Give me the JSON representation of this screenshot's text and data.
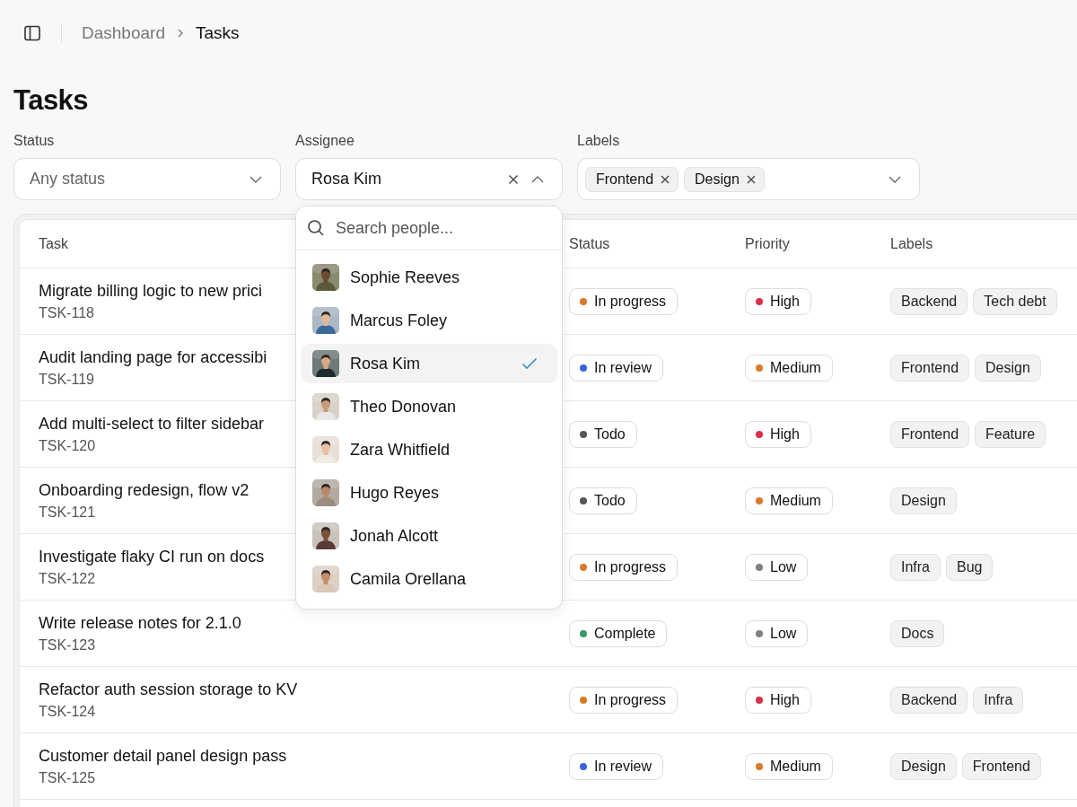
{
  "breadcrumb": [
    {
      "label": "Dashboard",
      "current": false
    },
    {
      "label": "Tasks",
      "current": true
    }
  ],
  "title": "Tasks",
  "filters": [
    {
      "kind": "select",
      "label": "Status",
      "placeholder": "Any status",
      "expanded": false
    },
    {
      "kind": "select",
      "label": "Assignee",
      "value": "Rosa Kim",
      "expanded": true,
      "clearable": true
    },
    {
      "kind": "tags",
      "label": "Labels",
      "tags": [
        "Frontend",
        "Design"
      ],
      "expanded": false
    }
  ],
  "people_menu": {
    "search_placeholder": "Search people...",
    "people": [
      {
        "name": "Sophie Reeves",
        "selected": false
      },
      {
        "name": "Marcus Foley",
        "selected": false
      },
      {
        "name": "Rosa Kim",
        "selected": true
      },
      {
        "name": "Theo Donovan",
        "selected": false
      },
      {
        "name": "Zara Whitfield",
        "selected": false
      },
      {
        "name": "Hugo Reyes",
        "selected": false
      },
      {
        "name": "Jonah Alcott",
        "selected": false
      },
      {
        "name": "Camila Orellana",
        "selected": false
      }
    ]
  },
  "table": {
    "columns": [
      "Task",
      "Status",
      "Priority",
      "Labels"
    ],
    "rows": [
      {
        "title": "Migrate billing logic to new prici",
        "id": "TSK-118",
        "status": {
          "text": "In progress",
          "color": "#d97a2b"
        },
        "priority": {
          "text": "High",
          "color": "#d9304a"
        },
        "labels": [
          "Backend",
          "Tech debt"
        ]
      },
      {
        "title": "Audit landing page for accessibi",
        "id": "TSK-119",
        "status": {
          "text": "In review",
          "color": "#3b63e0"
        },
        "priority": {
          "text": "Medium",
          "color": "#d97a2b"
        },
        "labels": [
          "Frontend",
          "Design"
        ]
      },
      {
        "title": "Add multi-select to filter sidebar",
        "id": "TSK-120",
        "status": {
          "text": "Todo",
          "color": "#555555"
        },
        "priority": {
          "text": "High",
          "color": "#d9304a"
        },
        "labels": [
          "Frontend",
          "Feature"
        ]
      },
      {
        "title": "Onboarding redesign, flow v2",
        "id": "TSK-121",
        "status": {
          "text": "Todo",
          "color": "#555555"
        },
        "priority": {
          "text": "Medium",
          "color": "#d97a2b"
        },
        "labels": [
          "Design"
        ]
      },
      {
        "title": "Investigate flaky CI run on docs",
        "id": "TSK-122",
        "status": {
          "text": "In progress",
          "color": "#d97a2b"
        },
        "priority": {
          "text": "Low",
          "color": "#808080"
        },
        "labels": [
          "Infra",
          "Bug"
        ]
      },
      {
        "title": "Write release notes for 2.1.0",
        "id": "TSK-123",
        "status": {
          "text": "Complete",
          "color": "#3a9a6a"
        },
        "priority": {
          "text": "Low",
          "color": "#808080"
        },
        "labels": [
          "Docs"
        ]
      },
      {
        "title": "Refactor auth session storage to KV",
        "id": "TSK-124",
        "status": {
          "text": "In progress",
          "color": "#d97a2b"
        },
        "priority": {
          "text": "High",
          "color": "#d9304a"
        },
        "labels": [
          "Backend",
          "Infra"
        ]
      },
      {
        "title": "Customer detail panel design pass",
        "id": "TSK-125",
        "status": {
          "text": "In review",
          "color": "#3b63e0"
        },
        "priority": {
          "text": "Medium",
          "color": "#d97a2b"
        },
        "labels": [
          "Design",
          "Frontend"
        ]
      }
    ]
  }
}
